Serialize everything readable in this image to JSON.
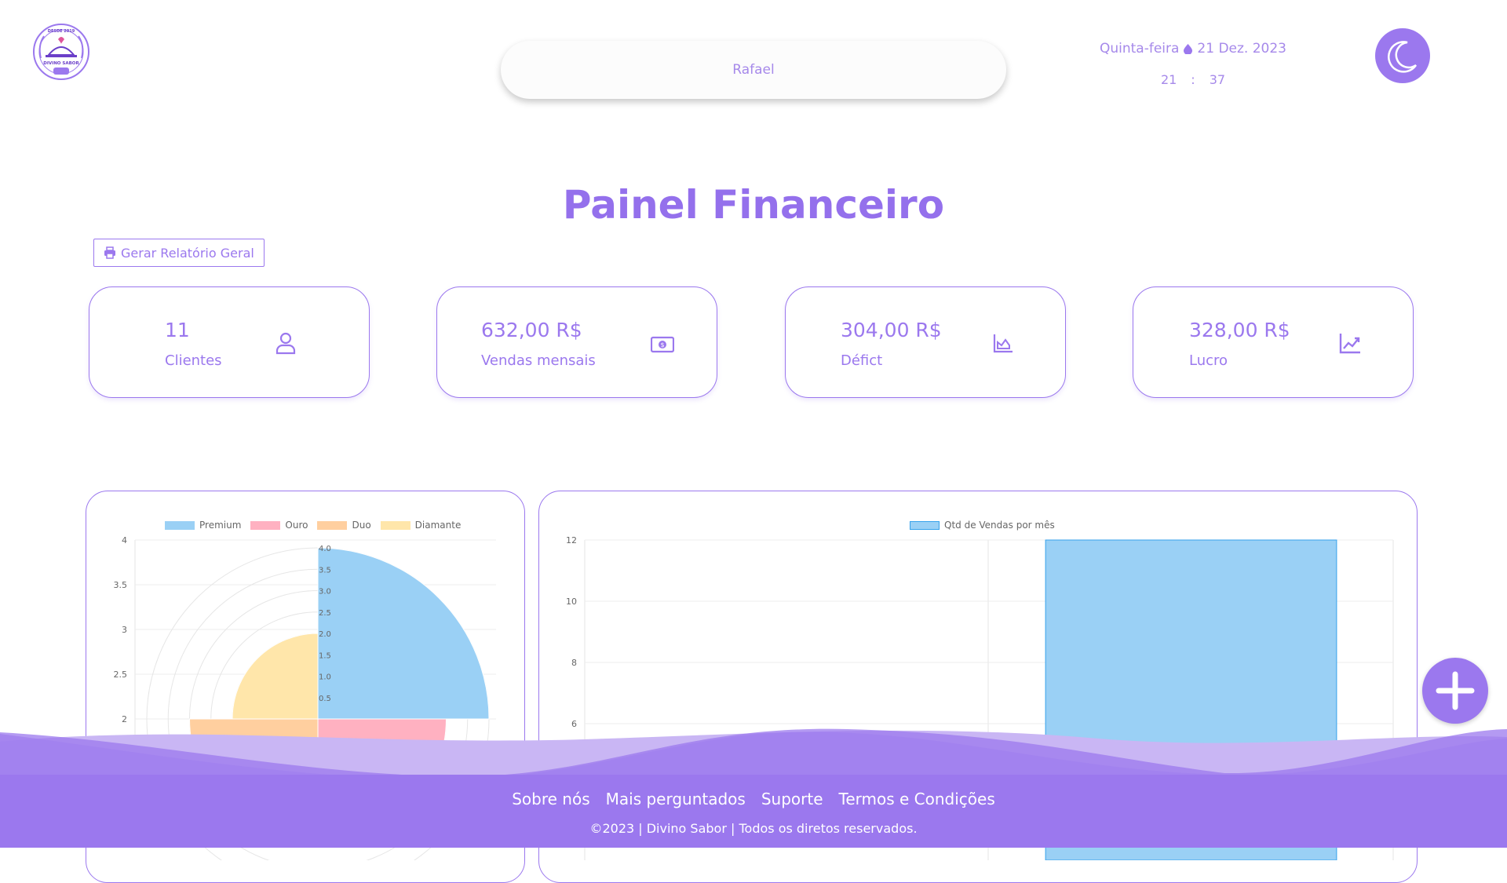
{
  "header": {
    "logo_icon": "divino-sabor-seal-logo",
    "logo_text": [
      "DESDE 2019",
      "DIVINO SABOR"
    ],
    "search_value": "Rafael",
    "date": {
      "weekday": "Quinta-feira",
      "date": "21 Dez. 2023",
      "separator_icon": "drop-icon"
    },
    "time": {
      "hours": "21",
      "separator": ":",
      "minutes": "37"
    },
    "theme_toggle_icon": "moon-icon"
  },
  "page": {
    "title": "Painel Financeiro",
    "report_button": {
      "label": "Gerar Relatório Geral",
      "icon": "printer-icon"
    }
  },
  "cards": [
    {
      "value": "11",
      "label": "Clientes",
      "icon": "user-icon"
    },
    {
      "value": "632,00 R$",
      "label": "Vendas mensais",
      "icon": "money-bill-icon"
    },
    {
      "value": "304,00 R$",
      "label": "Défict",
      "icon": "chart-area-icon"
    },
    {
      "value": "328,00 R$",
      "label": "Lucro",
      "icon": "chart-line-icon"
    }
  ],
  "chart_data": [
    {
      "type": "polarArea",
      "categories": [
        "Premium",
        "Ouro",
        "Duo",
        "Diamante"
      ],
      "values": [
        4,
        3,
        3,
        2
      ],
      "colors": [
        "#9ad0f5",
        "#ffb1c1",
        "#ffcf9f",
        "#ffe6aa"
      ],
      "y_ticks": [
        "4",
        "3.5",
        "3",
        "2.5",
        "2"
      ],
      "r_ticks": [
        "4.0",
        "3.5",
        "3.0",
        "2.5",
        "2.0",
        "1.5",
        "1.0",
        "0.5"
      ],
      "r_max": 4
    },
    {
      "type": "bar",
      "series": [
        {
          "name": "Qtd de Vendas por mês",
          "color": "#9ad0f5",
          "values": [
            0,
            12
          ]
        }
      ],
      "y_ticks": [
        "12",
        "10",
        "8",
        "6"
      ],
      "ylim": [
        6,
        12
      ]
    }
  ],
  "fab_icon": "plus-icon",
  "footer": {
    "links": [
      "Sobre nós",
      "Mais perguntados",
      "Suporte",
      "Termos e Condições"
    ],
    "copyright": "©2023 | Divino Sabor | Todos os diretos reservados."
  },
  "colors": {
    "accent": "#9b78ee",
    "title": "#9470ec",
    "wave": "#9b78ee"
  }
}
